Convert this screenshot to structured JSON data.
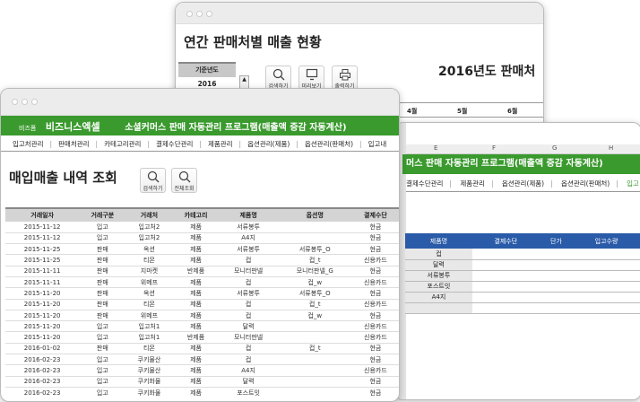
{
  "win_annual": {
    "title": "연간 판매처별 매출 현황",
    "year_label": "기준년도",
    "year_value": "2016",
    "buttons": [
      "검색하기",
      "미리보기",
      "출력하기"
    ],
    "report_title": "2016년도 판매처",
    "months": [
      "4월",
      "5월",
      "6월"
    ]
  },
  "win_product": {
    "columns": [
      "E",
      "F",
      "G",
      "H"
    ],
    "banner": "머스 판매 자동관리 프로그램(매출액 증감 자동계산)",
    "nav": [
      "결제수단관리",
      "제품관리",
      "옵션관리(제품)",
      "옵션관리(판매처)",
      "입고"
    ],
    "headers": [
      "제품명",
      "결제수단",
      "단가",
      "입고수량"
    ],
    "rows": [
      "컵",
      "달력",
      "서류봉투",
      "포스트잇",
      "A4지"
    ]
  },
  "win_main": {
    "brand_small": "비즈폼",
    "brand": "비즈니스엑셀",
    "banner": "소셜커머스 판매 자동관리 프로그램(매출액 증감 자동계산)",
    "nav": [
      "입고처관리",
      "판매처관리",
      "카테고리관리",
      "결제수단관리",
      "제품관리",
      "옵션관리(제품)",
      "옵션관리(판매처)",
      "입고내"
    ],
    "heading": "매입매출 내역 조회",
    "buttons": [
      "검색하기",
      "전체조회"
    ],
    "headers": [
      "거래일자",
      "거래구분",
      "거래처",
      "카테고리",
      "제품명",
      "옵션명",
      "결제수단"
    ],
    "rows": [
      [
        "2015-11-12",
        "입고",
        "입고처2",
        "제품",
        "서류봉투",
        "",
        "현금"
      ],
      [
        "2015-11-12",
        "입고",
        "입고처2",
        "제품",
        "A4지",
        "",
        "현금"
      ],
      [
        "2015-11-25",
        "판매",
        "옥션",
        "제품",
        "서류봉투",
        "서류봉투_O",
        "현금"
      ],
      [
        "2015-11-25",
        "판매",
        "티몬",
        "제품",
        "컵",
        "컵_t",
        "신용카드"
      ],
      [
        "2015-11-11",
        "판매",
        "지마켓",
        "반제품",
        "모니터판넬",
        "모니터판넬_G",
        "현금"
      ],
      [
        "2015-11-11",
        "판매",
        "위메프",
        "제품",
        "컵",
        "컵_w",
        "신용카드"
      ],
      [
        "2015-11-20",
        "판매",
        "옥션",
        "제품",
        "서류봉투",
        "서류봉투_O",
        "현금"
      ],
      [
        "2015-11-20",
        "판매",
        "티몬",
        "제품",
        "컵",
        "컵_t",
        "신용카드"
      ],
      [
        "2015-11-20",
        "판매",
        "위메프",
        "제품",
        "컵",
        "컵_w",
        "현금"
      ],
      [
        "2015-11-20",
        "입고",
        "입고처1",
        "제품",
        "달력",
        "",
        "신용카드"
      ],
      [
        "2015-11-20",
        "입고",
        "입고처1",
        "반제품",
        "모니터판넬",
        "",
        "신용카드"
      ],
      [
        "2016-01-02",
        "판매",
        "티몬",
        "제품",
        "컵",
        "컵_t",
        "현금"
      ],
      [
        "2016-02-23",
        "입고",
        "쿠키물산",
        "제품",
        "컵",
        "",
        "현금"
      ],
      [
        "2016-02-23",
        "입고",
        "쿠키물산",
        "제품",
        "A4지",
        "",
        "신용카드"
      ],
      [
        "2016-02-23",
        "입고",
        "쿠키화물",
        "제품",
        "달력",
        "",
        "현금"
      ],
      [
        "2016-02-23",
        "입고",
        "쿠키화물",
        "제품",
        "포스트잇",
        "",
        "현금"
      ]
    ]
  },
  "colors": {
    "green": "#3a9a2e",
    "blue": "#2a5ba8"
  }
}
